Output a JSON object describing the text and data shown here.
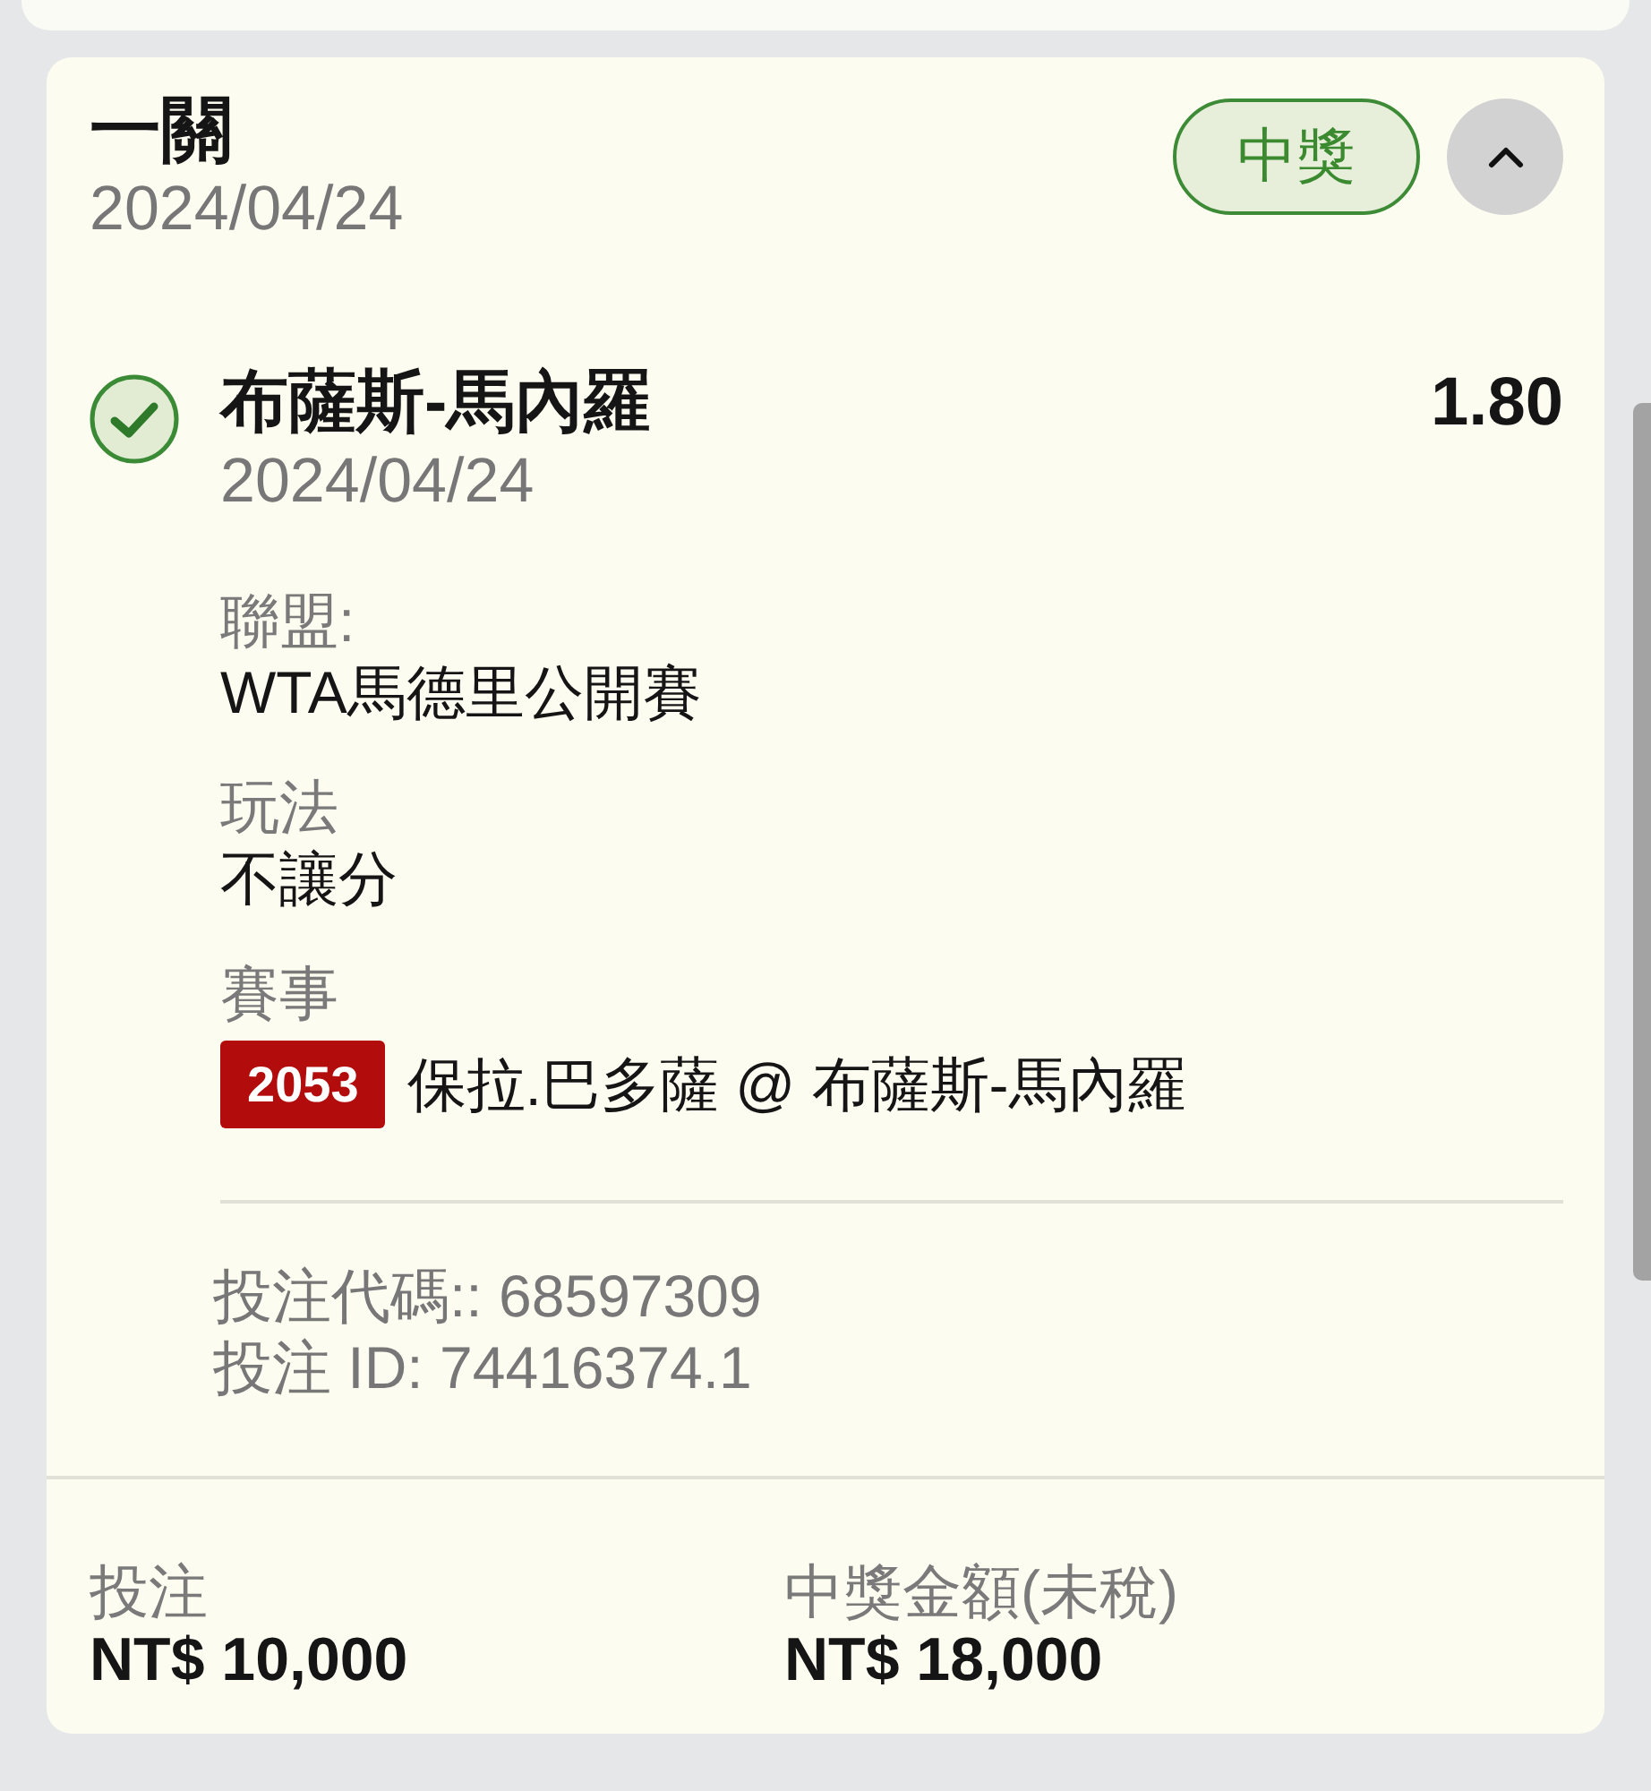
{
  "ticket": {
    "title": "一關",
    "date": "2024/04/24",
    "status": {
      "label": "中獎",
      "kind": "won"
    },
    "expanded": true
  },
  "selection": {
    "won": true,
    "name": "布薩斯-馬內羅",
    "date": "2024/04/24",
    "odds": "1.80",
    "details": [
      {
        "label": "聯盟:",
        "value": "WTA馬德里公開賽"
      },
      {
        "label": "玩法",
        "value": "不讓分"
      },
      {
        "label": "賽事",
        "code": "2053",
        "value": "保拉.巴多薩 @ 布薩斯-馬內羅"
      }
    ]
  },
  "bet_code": "投注代碼:: 68597309",
  "bet_id": "投注 ID: 74416374.1",
  "footer": [
    {
      "label": "投注",
      "value": "NT$ 10,000"
    },
    {
      "label": "中獎金額(未稅)",
      "value": "NT$ 18,000"
    }
  ]
}
